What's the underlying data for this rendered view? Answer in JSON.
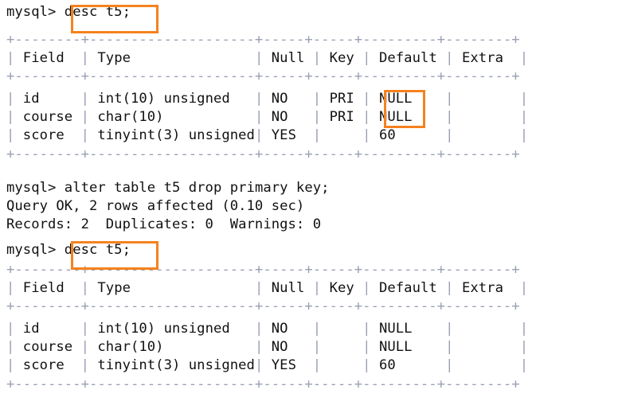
{
  "terminal": {
    "prompt": "mysql>",
    "char_width": 12.2,
    "line_height": 23.5,
    "colors": {
      "background": "#ffffff",
      "text": "#111111",
      "table_border": "#9aa0b4",
      "highlight": "#f5821f"
    }
  },
  "table_layout": {
    "rule": "+--------+--------------------+-----+-----+---------+--------+",
    "columns": [
      {
        "name": "Field",
        "width": 8
      },
      {
        "name": "Type",
        "width": 20
      },
      {
        "name": "Null",
        "width": 5
      },
      {
        "name": "Key",
        "width": 5
      },
      {
        "name": "Default",
        "width": 9
      },
      {
        "name": "Extra",
        "width": 8
      }
    ]
  },
  "blocks": [
    {
      "id": "cmd-desc-1",
      "kind": "command",
      "prompt": "mysql>",
      "command": "desc t5;",
      "highlighted": true
    },
    {
      "id": "table-1",
      "kind": "table",
      "headers": [
        "Field",
        "Type",
        "Null",
        "Key",
        "Default",
        "Extra"
      ],
      "rows": [
        {
          "Field": "id",
          "Type": "int(10) unsigned",
          "Null": "NO",
          "Key": "PRI",
          "Default": "NULL",
          "Extra": ""
        },
        {
          "Field": "course",
          "Type": "char(10)",
          "Null": "NO",
          "Key": "PRI",
          "Default": "NULL",
          "Extra": ""
        },
        {
          "Field": "score",
          "Type": "tinyint(3) unsigned",
          "Null": "YES",
          "Key": "",
          "Default": "60",
          "Extra": ""
        }
      ],
      "highlighted_cells": [
        "Key"
      ]
    },
    {
      "id": "cmd-alter",
      "kind": "command",
      "prompt": "mysql>",
      "command": "alter table t5 drop primary key;",
      "highlighted": false
    },
    {
      "id": "result-alter",
      "kind": "result",
      "lines": [
        "Query OK, 2 rows affected (0.10 sec)",
        "Records: 2  Duplicates: 0  Warnings: 0"
      ]
    },
    {
      "id": "cmd-desc-2",
      "kind": "command",
      "prompt": "mysql>",
      "command": "desc t5;",
      "highlighted": true
    },
    {
      "id": "table-2",
      "kind": "table",
      "headers": [
        "Field",
        "Type",
        "Null",
        "Key",
        "Default",
        "Extra"
      ],
      "rows": [
        {
          "Field": "id",
          "Type": "int(10) unsigned",
          "Null": "NO",
          "Key": "",
          "Default": "NULL",
          "Extra": ""
        },
        {
          "Field": "course",
          "Type": "char(10)",
          "Null": "NO",
          "Key": "",
          "Default": "NULL",
          "Extra": ""
        },
        {
          "Field": "score",
          "Type": "tinyint(3) unsigned",
          "Null": "YES",
          "Key": "",
          "Default": "60",
          "Extra": ""
        }
      ],
      "highlighted_cells": []
    }
  ],
  "lines": {
    "l00_prompt": "mysql>",
    "l00_cmd": "desc t5;",
    "l01_rule": "+--------+--------------------+-----+-----+---------+--------+",
    "l02_header": "| Field  | Type               | Null | Key | Default | Extra  |",
    "l03_rule": "+--------+--------------------+-----+-----+---------+--------+",
    "l04_row": "| id     | int(10) unsigned   | NO   | PRI | NULL    |        |",
    "l05_row": "| course | char(10)           | NO   | PRI | NULL    |        |",
    "l06_row": "| score  | tinyint(3) unsigned| YES  |     | 60      |        |",
    "l07_rule": "+--------+--------------------+-----+-----+---------+--------+",
    "l09_prompt": "mysql>",
    "l09_cmd": "alter table t5 drop primary key;",
    "l10": "Query OK, 2 rows affected (0.10 sec)",
    "l11": "Records: 2  Duplicates: 0  Warnings: 0",
    "l12_prompt": "mysql>",
    "l12_cmd": "desc t5;",
    "l13_rule": "+--------+--------------------+-----+-----+---------+--------+",
    "l14_header": "| Field  | Type               | Null | Key | Default | Extra  |",
    "l15_rule": "+--------+--------------------+-----+-----+---------+--------+",
    "l16_row": "| id     | int(10) unsigned   | NO   |     | NULL    |        |",
    "l17_row": "| course | char(10)           | NO   |     | NULL    |        |",
    "l18_row": "| score  | tinyint(3) unsigned| YES  |     | 60      |        |",
    "l19_rule": "+--------+--------------------+-----+-----+---------+--------+"
  },
  "segments": {
    "pipe": "|",
    "hdr_field": " Field  ",
    "hdr_type": " Type               ",
    "hdr_null": " Null ",
    "hdr_key": " Key ",
    "hdr_default": " Default ",
    "hdr_extra": " Extra  ",
    "r1_field": " id     ",
    "r1_type": " int(10) unsigned   ",
    "r1_null": " NO   ",
    "r1_key": " PRI ",
    "r1_default": " NULL    ",
    "r1_extra": "        ",
    "r2_field": " course ",
    "r2_type": " char(10)           ",
    "r2_null": " NO   ",
    "r2_key": " PRI ",
    "r2_default": " NULL    ",
    "r2_extra": "        ",
    "r3_field": " score  ",
    "r3_type": " tinyint(3) unsigned",
    "r3_null": " YES  ",
    "r3_key": "     ",
    "r3_default": " 60      ",
    "r3_extra": "        ",
    "b1_key": "     ",
    "b2_key": "     ",
    "b3_key": "     "
  }
}
